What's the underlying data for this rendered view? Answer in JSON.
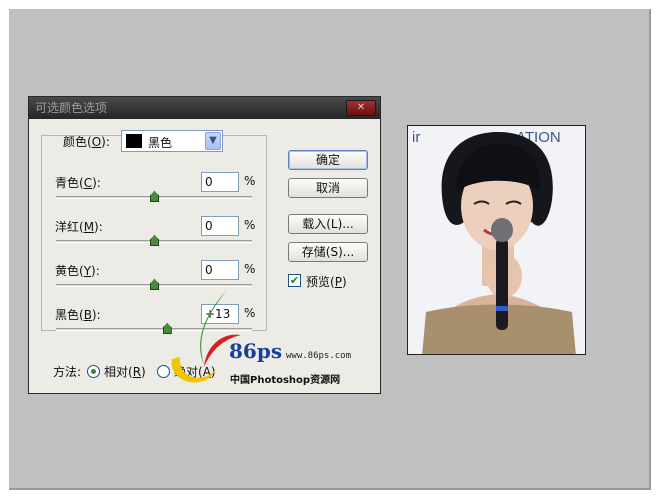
{
  "dialog": {
    "title": "可选颜色选项",
    "color_label_pre": "颜色(",
    "color_label_key": "O",
    "color_label_post": "):",
    "color_selected": "黑色",
    "sliders": [
      {
        "pre": "青色(",
        "key": "C",
        "post": "):",
        "value": "0",
        "level": 0
      },
      {
        "pre": "洋红(",
        "key": "M",
        "post": "):",
        "value": "0",
        "level": 0
      },
      {
        "pre": "黄色(",
        "key": "Y",
        "post": "):",
        "value": "0",
        "level": 0
      },
      {
        "pre": "黑色(",
        "key": "B",
        "post": "):",
        "value": "+13",
        "level": 13
      }
    ],
    "percent": "%",
    "buttons": {
      "ok": "确定",
      "cancel": "取消",
      "load": "载入(L)...",
      "save": "存储(S)..."
    },
    "preview": {
      "pre": "预览(",
      "key": "P",
      "post": ")",
      "checked": true
    },
    "method": {
      "label": "方法:",
      "relative_pre": "相对(",
      "relative_key": "R",
      "relative_post": ")",
      "absolute_pre": "绝对(",
      "absolute_key": "A",
      "absolute_post": ")",
      "selected": "relative"
    }
  },
  "watermark": {
    "brand": "86ps",
    "url": "www.86ps.com",
    "site_name": "中国Photoshop资源网"
  },
  "colors": {
    "canvas_bg": "#c0c0c0",
    "dialog_bg": "#ecebe6",
    "titlebar": "#2e2e2e",
    "slider_thumb": "#4a8a3a"
  }
}
